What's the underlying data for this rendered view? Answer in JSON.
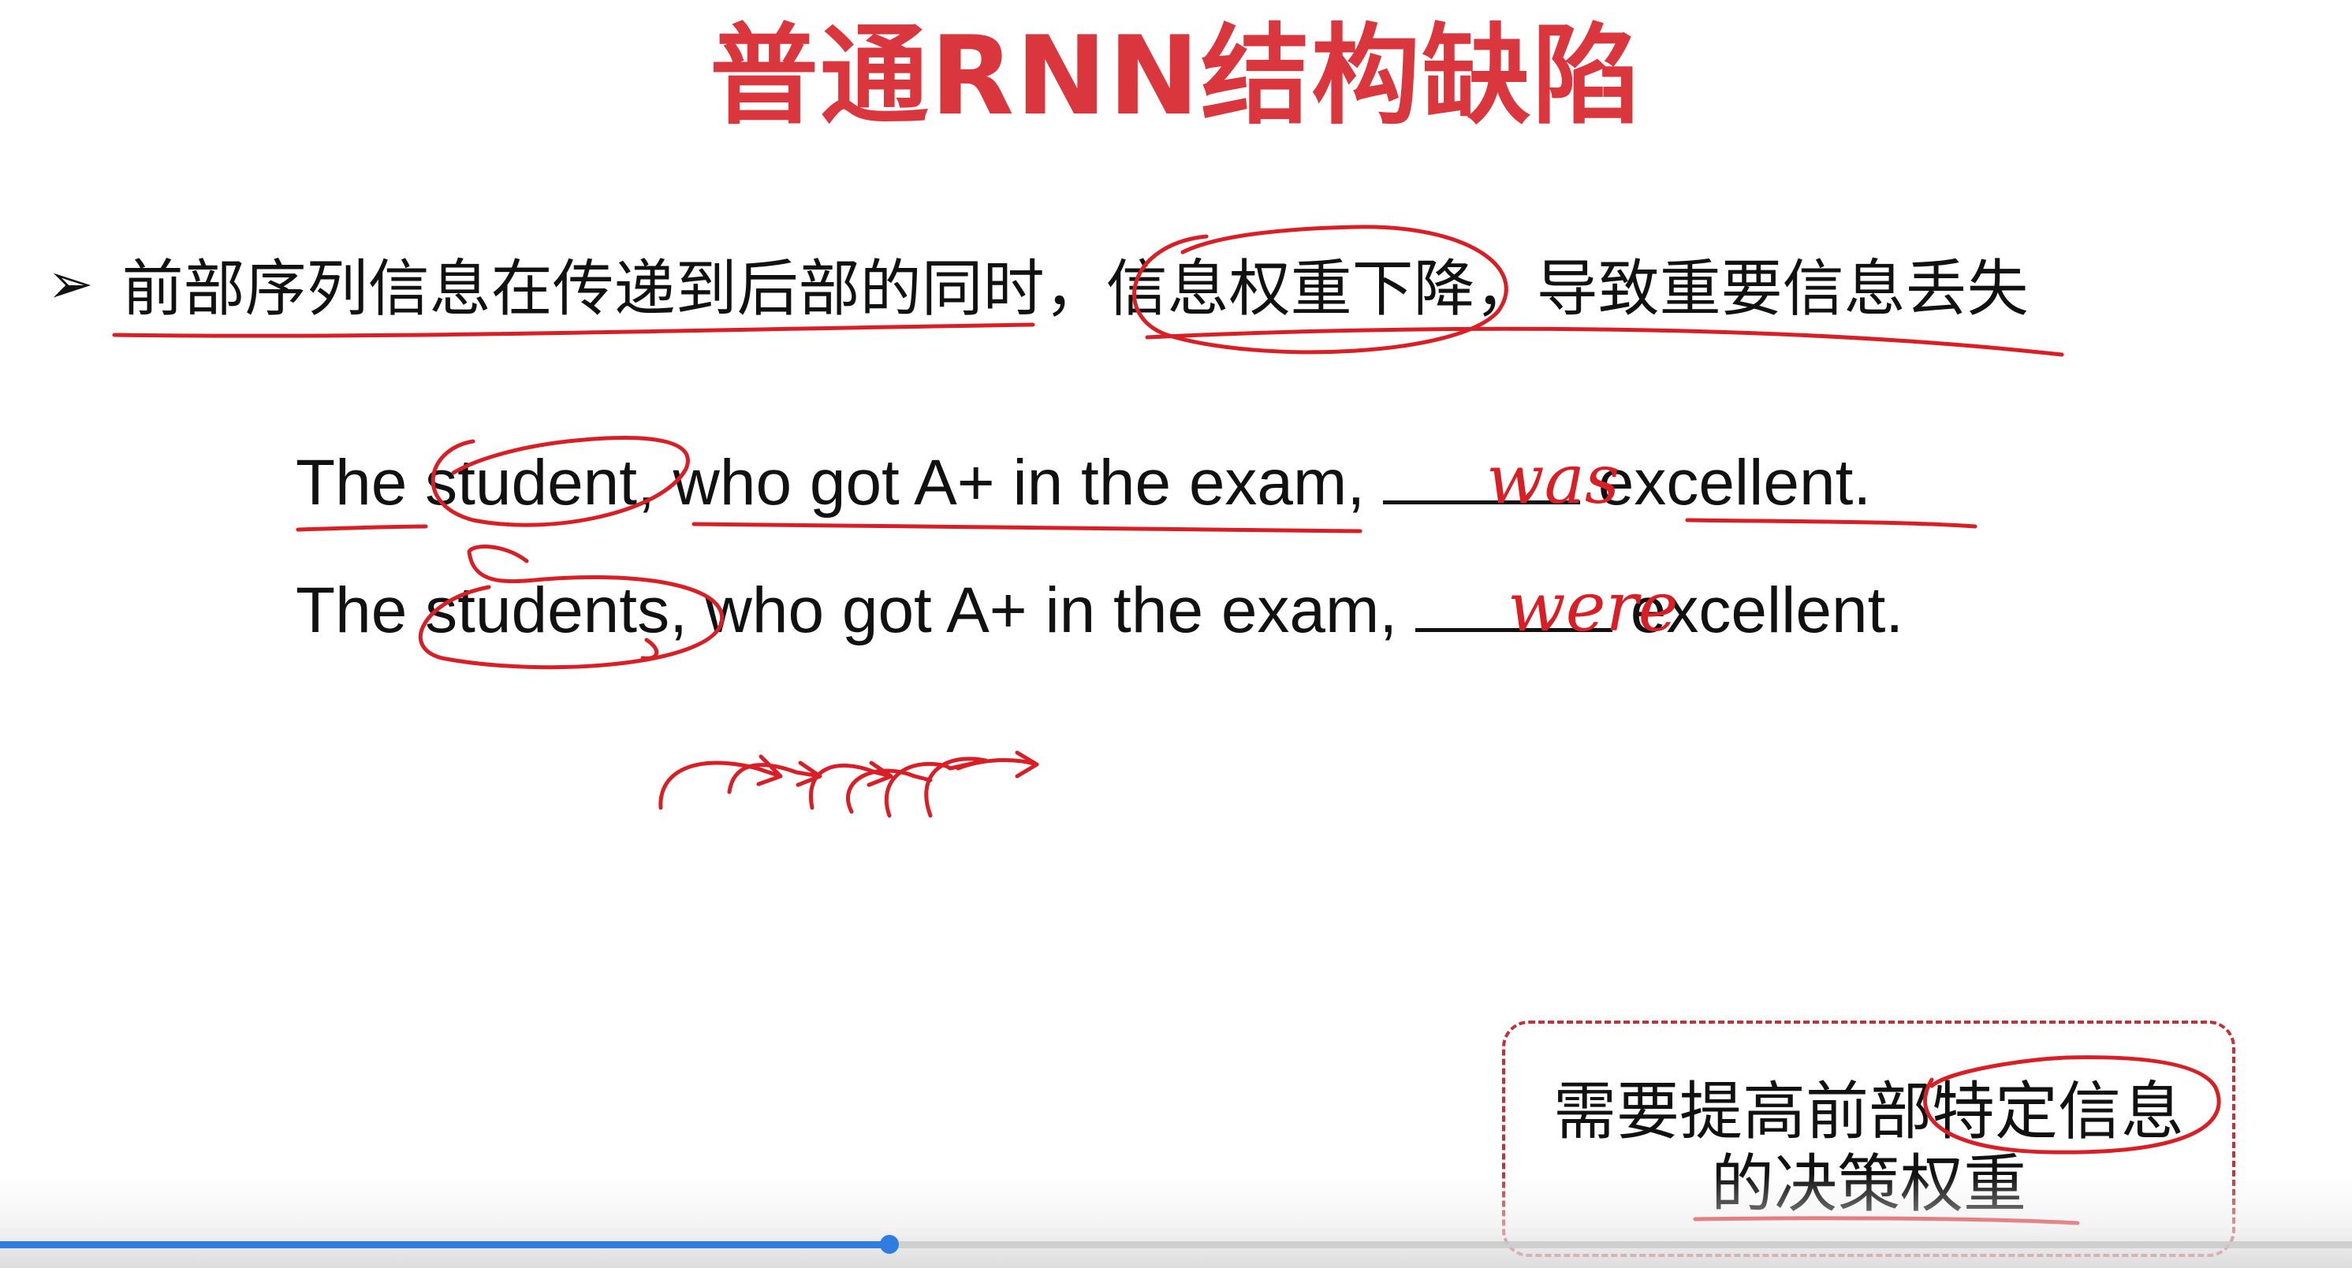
{
  "slide": {
    "title": "普通RNN结构缺陷",
    "bullet": {
      "marker": "➢",
      "text": "前部序列信息在传递到后部的同时，信息权重下降，导致重要信息丢失"
    },
    "sentences": [
      {
        "before": "The student, who got A+ in the exam,",
        "after": "excellent."
      },
      {
        "before": "The students, who got A+ in the exam,",
        "after": "excellent."
      }
    ],
    "handwriting": {
      "answer1": "was",
      "answer2": "were"
    },
    "note": {
      "line1": "需要提高前部特定信息",
      "line2": "的决策权重"
    }
  },
  "player": {
    "progress_fraction": 0.378
  },
  "colors": {
    "title": "#d9363e",
    "ink": "#d91f26",
    "progress": "#2f7de0",
    "note_border": "#c4303a"
  }
}
